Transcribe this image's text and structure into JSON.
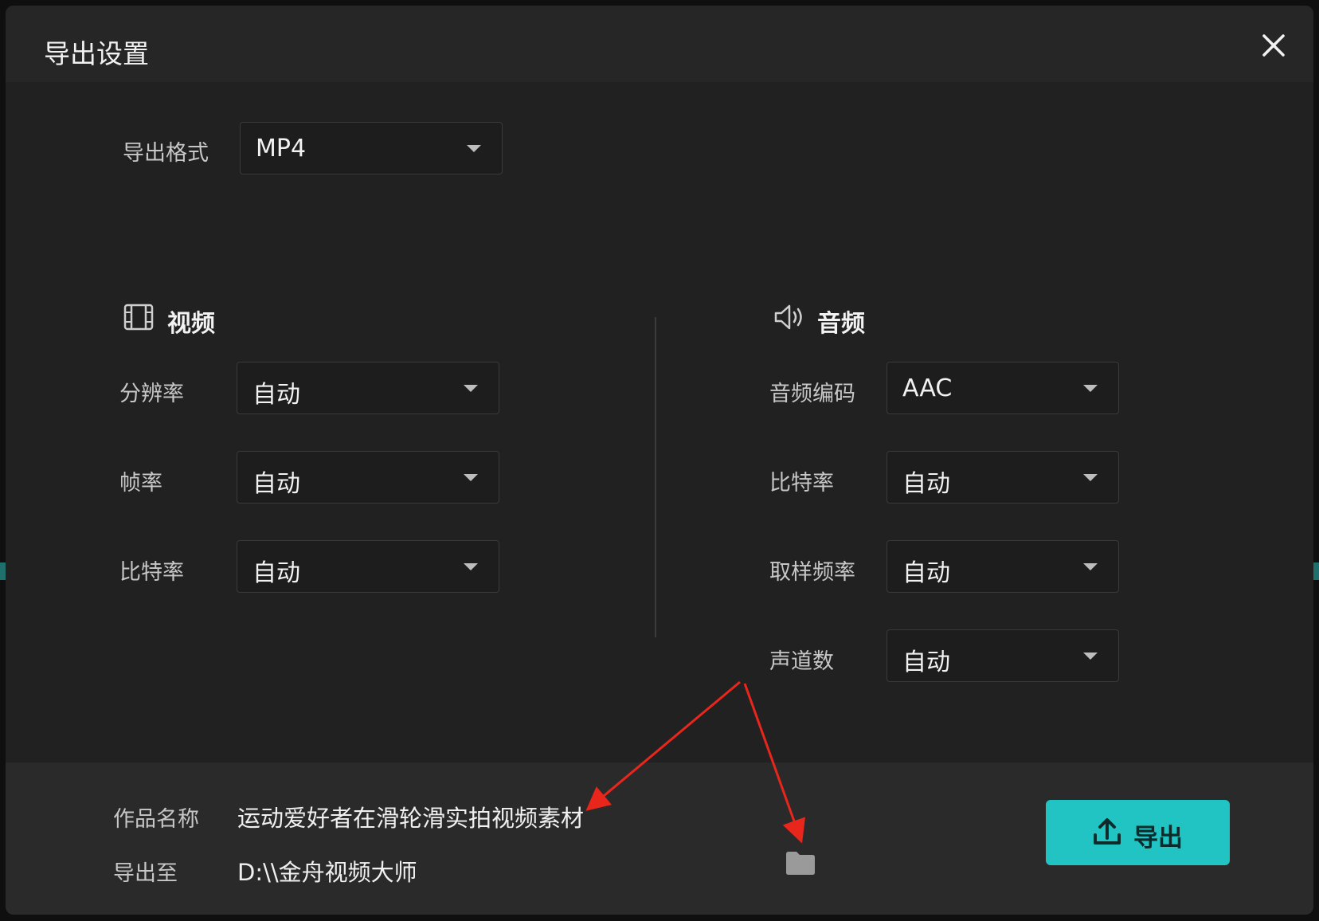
{
  "dialog": {
    "title": "导出设置",
    "close_icon": "close-icon"
  },
  "format": {
    "label": "导出格式",
    "value": "MP4"
  },
  "video": {
    "section_title": "视频",
    "icon": "film-icon",
    "fields": [
      {
        "label": "分辨率",
        "value": "自动"
      },
      {
        "label": "帧率",
        "value": "自动"
      },
      {
        "label": "比特率",
        "value": "自动"
      }
    ]
  },
  "audio": {
    "section_title": "音频",
    "icon": "speaker-icon",
    "fields": [
      {
        "label": "音频编码",
        "value": "AAC"
      },
      {
        "label": "比特率",
        "value": "自动"
      },
      {
        "label": "取样频率",
        "value": "自动"
      },
      {
        "label": "声道数",
        "value": "自动"
      }
    ]
  },
  "footer": {
    "name_label": "作品名称",
    "name_value": "运动爱好者在滑轮滑实拍视频素材",
    "path_label": "导出至",
    "path_value": "D:\\\\金舟视频大师",
    "folder_icon": "folder-icon",
    "export_label": "导出",
    "export_icon": "upload-icon"
  },
  "colors": {
    "accent": "#21c4c2",
    "annotation": "#e8261c"
  }
}
